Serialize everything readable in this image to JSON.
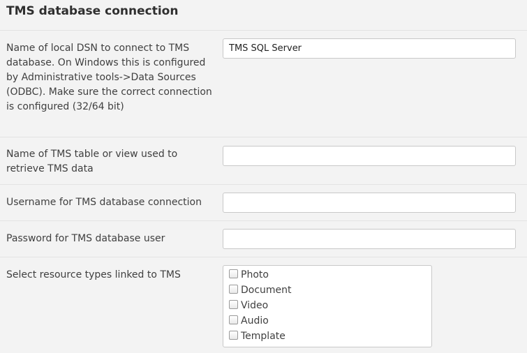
{
  "section": {
    "title": "TMS database connection"
  },
  "fields": {
    "dsn": {
      "label": "Name of local DSN to connect to TMS database. On Windows this is configured by Administrative tools->Data Sources (ODBC). Make sure the correct connection is configured (32/64 bit)",
      "value": "TMS SQL Server"
    },
    "table": {
      "label": "Name of TMS table or view used to retrieve TMS data",
      "value": ""
    },
    "username": {
      "label": "Username for TMS database connection",
      "value": ""
    },
    "password": {
      "label": "Password for TMS database user",
      "value": ""
    },
    "resource_types": {
      "label": "Select resource types linked to TMS",
      "options": [
        "Photo",
        "Document",
        "Video",
        "Audio",
        "Template"
      ]
    }
  }
}
